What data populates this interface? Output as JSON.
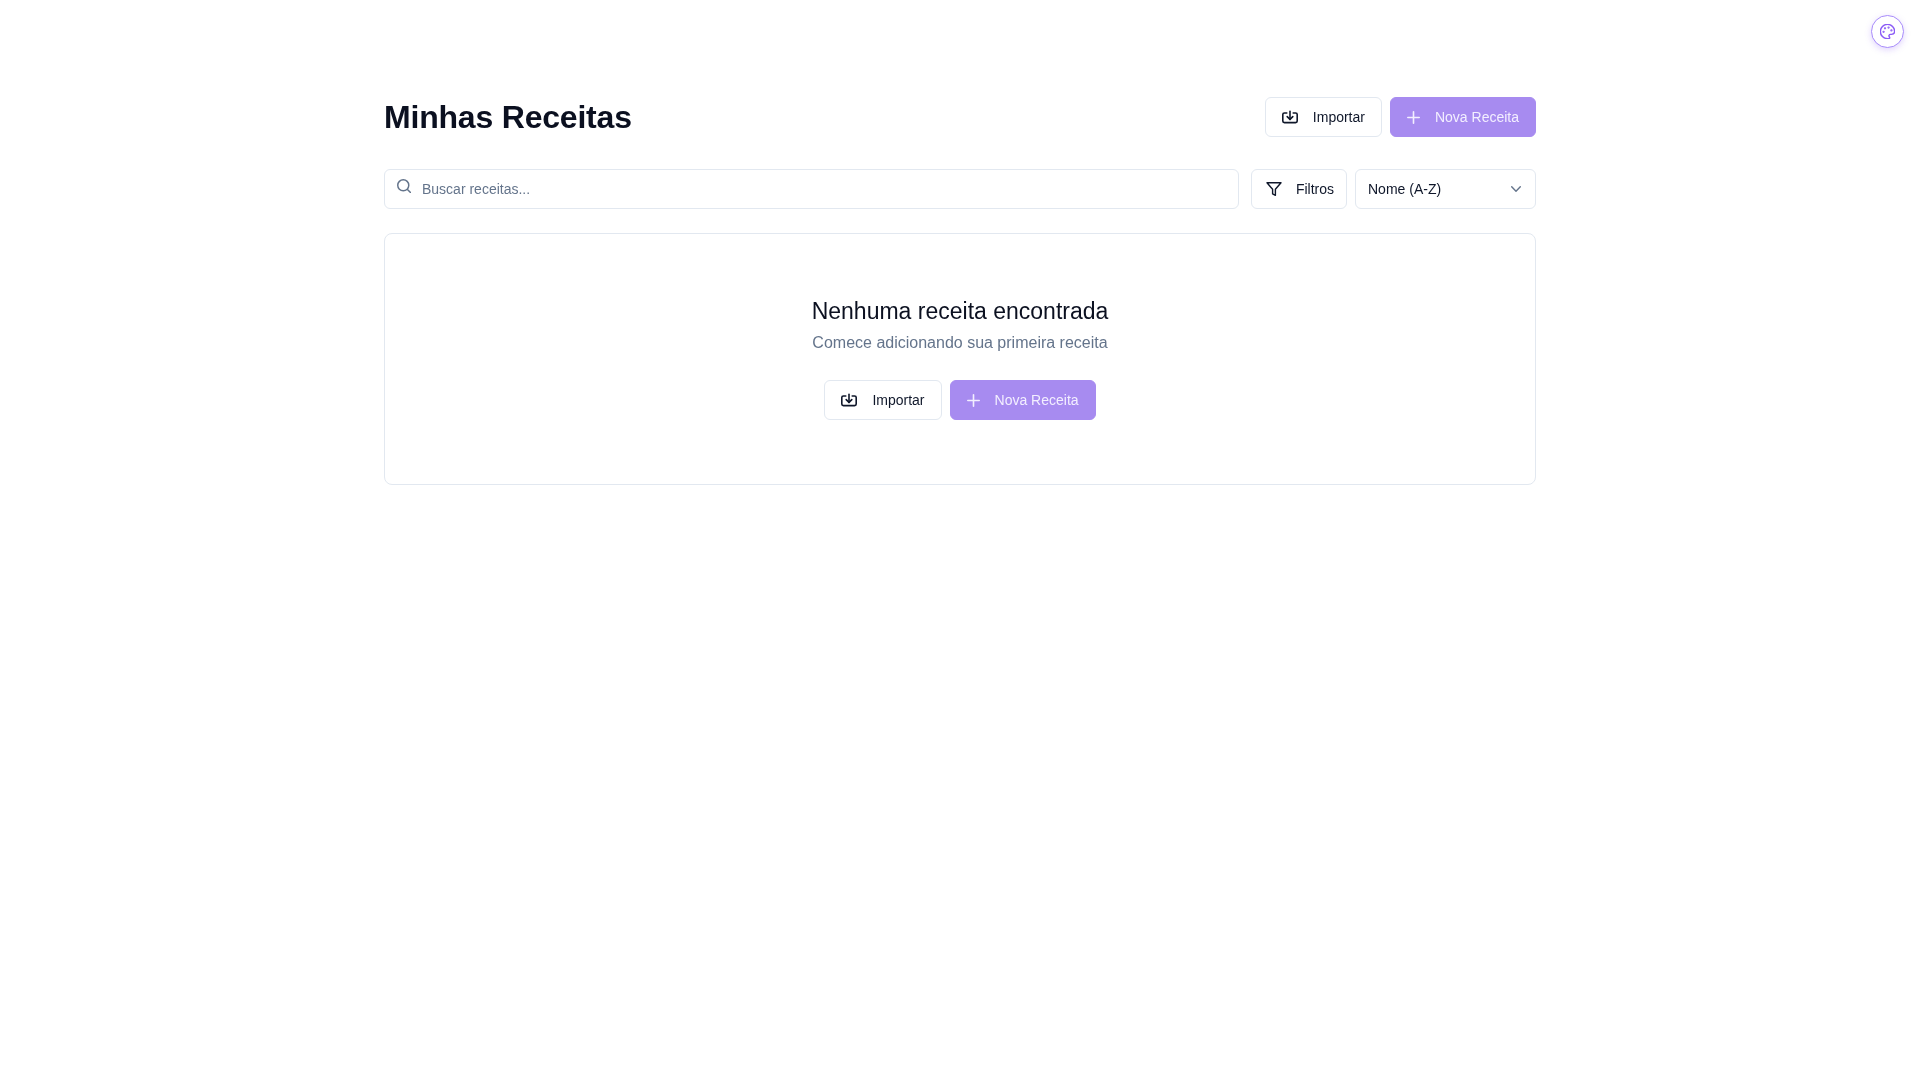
{
  "header": {
    "title": "Minhas Receitas",
    "actions": [
      {
        "kind": "outline",
        "label": "Importar"
      },
      {
        "kind": "primary",
        "label": "Nova Receita"
      }
    ]
  },
  "toolbar": {
    "search": {
      "placeholder": "Buscar receitas..."
    },
    "filter_button": {
      "label": "Filtros"
    },
    "sort": {
      "value": "Nome (A-Z)"
    }
  },
  "empty_state": {
    "title": "Nenhuma receita encontrada",
    "message": "Comece adicionando sua primeira receita",
    "actions": [
      {
        "kind": "outline",
        "label": "Importar"
      },
      {
        "kind": "primary",
        "label": "Nova Receita"
      }
    ]
  }
}
